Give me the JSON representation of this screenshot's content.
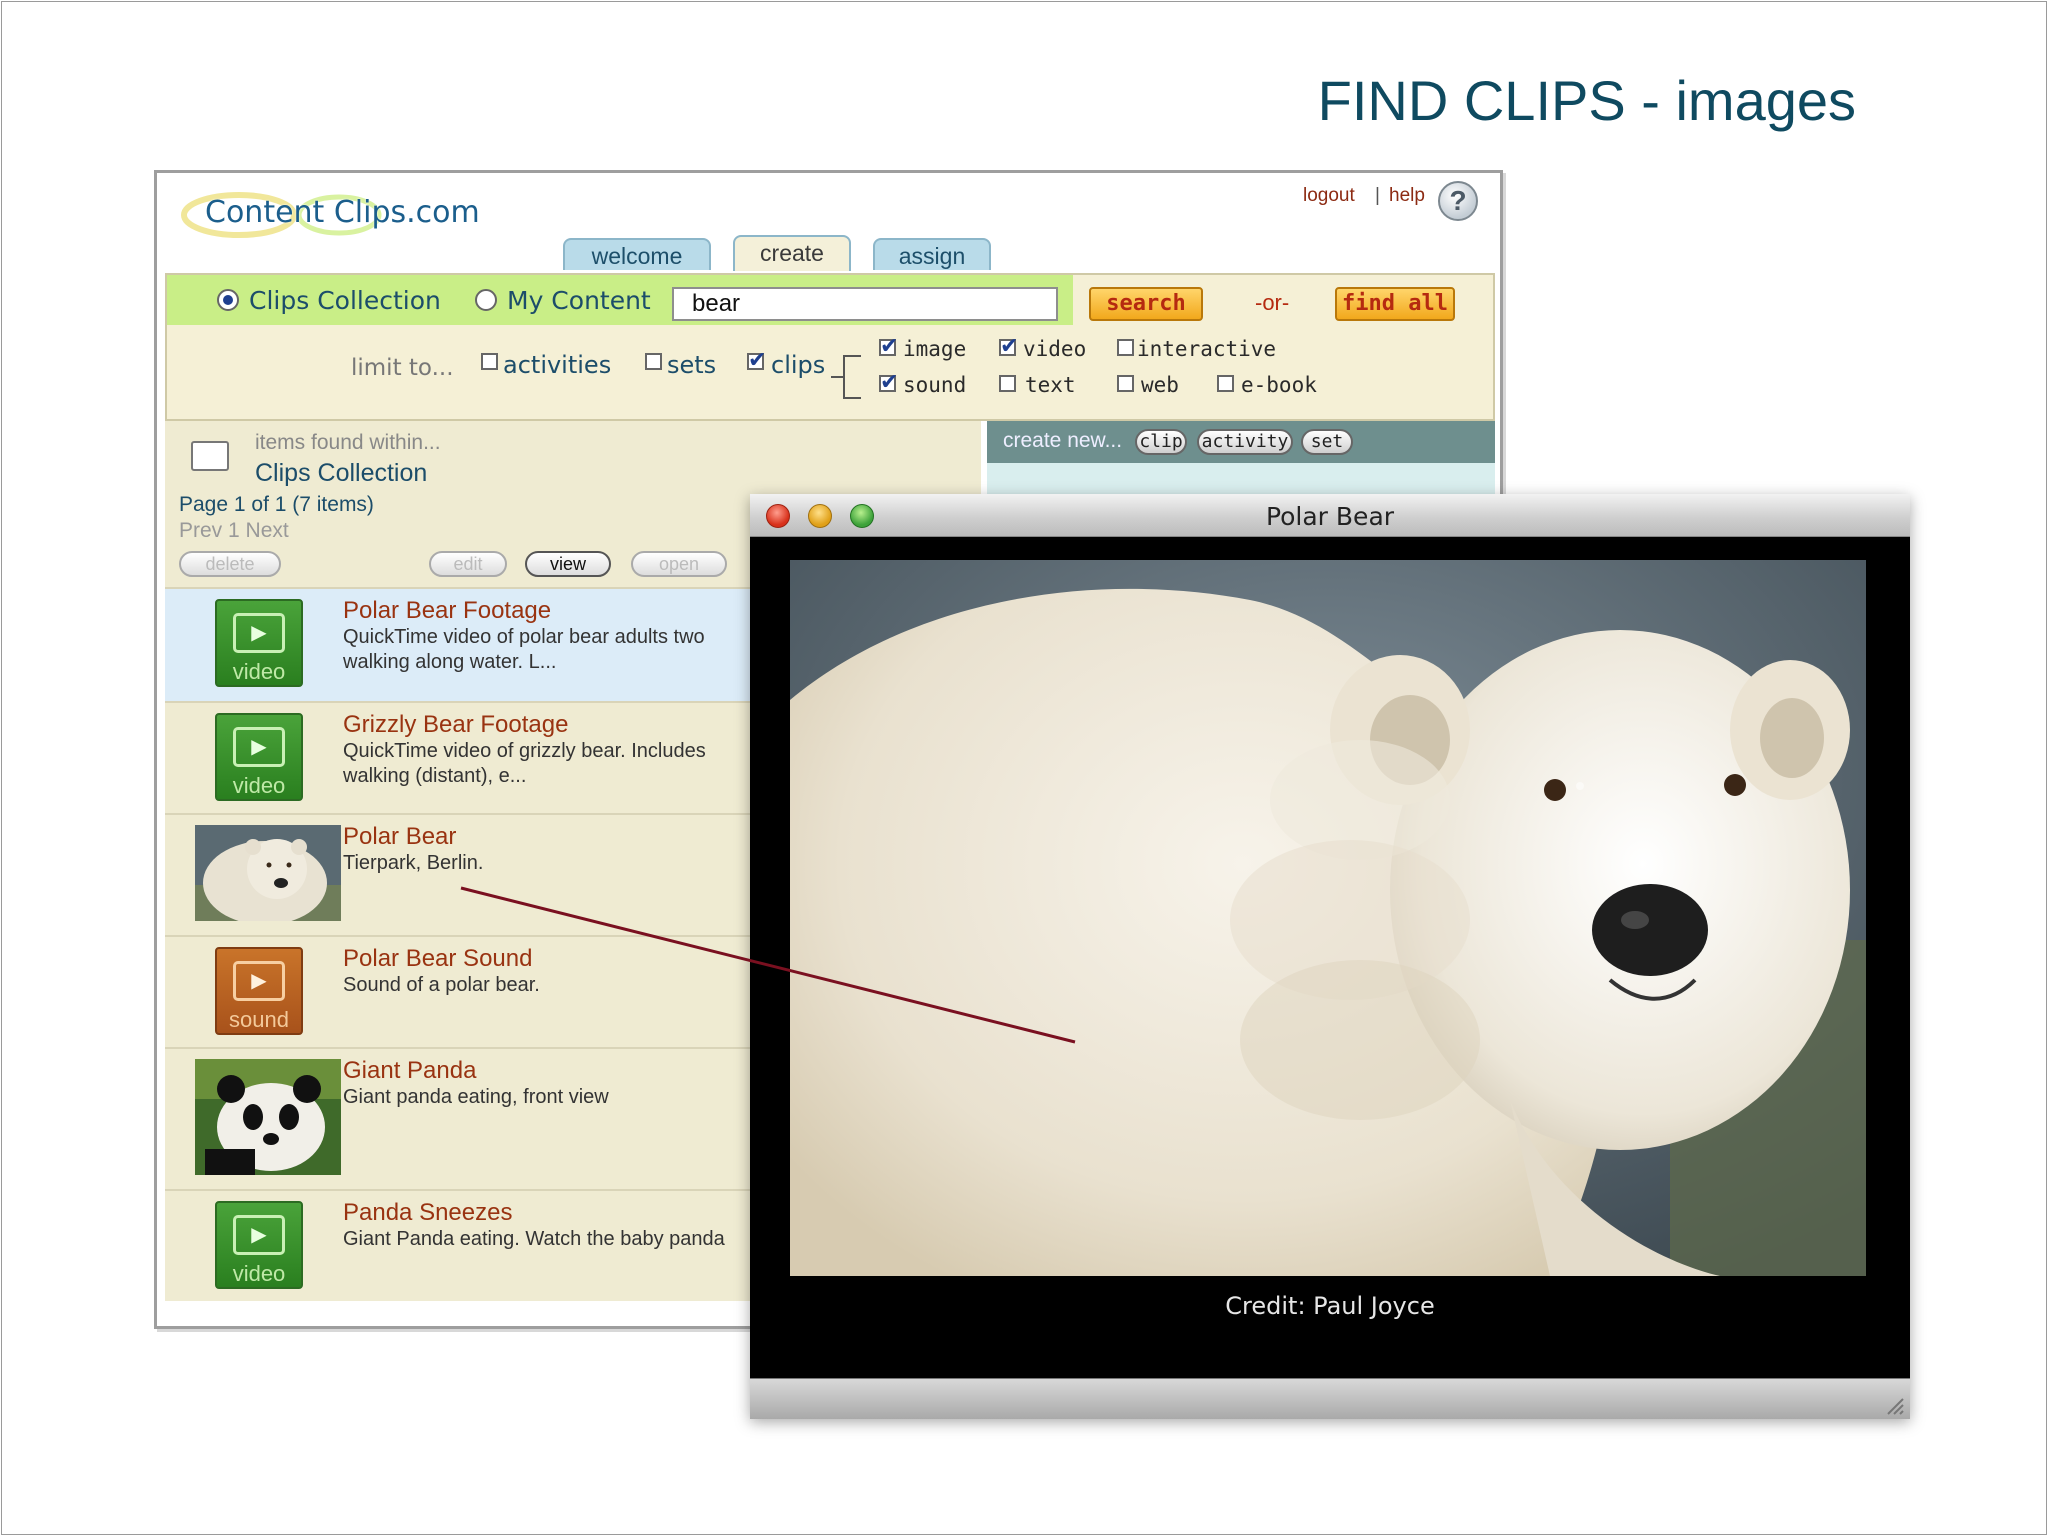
{
  "slide": {
    "title": "FIND CLIPS - images"
  },
  "app": {
    "logo": "Content Clips.com",
    "logout": "logout",
    "separator": "|",
    "help": "help",
    "help_icon": "question-mark-icon",
    "tabs": [
      {
        "label": "welcome",
        "active": false
      },
      {
        "label": "create",
        "active": true
      },
      {
        "label": "assign",
        "active": false
      }
    ],
    "scope": {
      "clips_collection": {
        "label": "Clips Collection",
        "selected": true
      },
      "my_content": {
        "label": "My Content",
        "selected": false
      }
    },
    "search": {
      "value": "bear",
      "button": "search",
      "or": "-or-",
      "find_all": "find all"
    },
    "limit": {
      "label": "limit to...",
      "activities": {
        "label": "activities",
        "checked": false
      },
      "sets": {
        "label": "sets",
        "checked": false
      },
      "clips": {
        "label": "clips",
        "checked": true
      },
      "types": [
        {
          "label": "image",
          "checked": true
        },
        {
          "label": "video",
          "checked": true
        },
        {
          "label": "interactive",
          "checked": false
        },
        {
          "label": "sound",
          "checked": true
        },
        {
          "label": "text",
          "checked": false
        },
        {
          "label": "web",
          "checked": false
        },
        {
          "label": "e-book",
          "checked": false
        }
      ]
    },
    "results": {
      "found_within": "items found within...",
      "collection": "Clips Collection",
      "page_info": "Page 1 of 1 (7 items)",
      "pager": "Prev  1  Next",
      "actions": {
        "delete": "delete",
        "edit": "edit",
        "view": "view",
        "open": "open"
      },
      "items": [
        {
          "title": "Polar Bear Footage",
          "desc": "QuickTime video of polar bear adults two walking along water. L...",
          "thumb": "video",
          "selected": true
        },
        {
          "title": "Grizzly Bear Footage",
          "desc": "QuickTime video of grizzly bear. Includes walking (distant), e...",
          "thumb": "video",
          "selected": false
        },
        {
          "title": "Polar Bear",
          "desc": "Tierpark, Berlin.",
          "thumb": "polar-bear-photo",
          "selected": false
        },
        {
          "title": "Polar Bear Sound",
          "desc": "Sound of a polar bear.",
          "thumb": "sound",
          "selected": false
        },
        {
          "title": "Giant Panda",
          "desc": "Giant panda eating, front view",
          "thumb": "panda-photo",
          "selected": false
        },
        {
          "title": "Panda Sneezes",
          "desc": "Giant Panda eating. Watch the baby panda",
          "thumb": "video",
          "selected": false
        }
      ]
    },
    "create_new": {
      "label": "create new...",
      "clip": "clip",
      "activity": "activity",
      "set": "set"
    }
  },
  "popup": {
    "title": "Polar Bear",
    "credit": "Credit: Paul Joyce",
    "accent_line_color": "#7a1020"
  }
}
